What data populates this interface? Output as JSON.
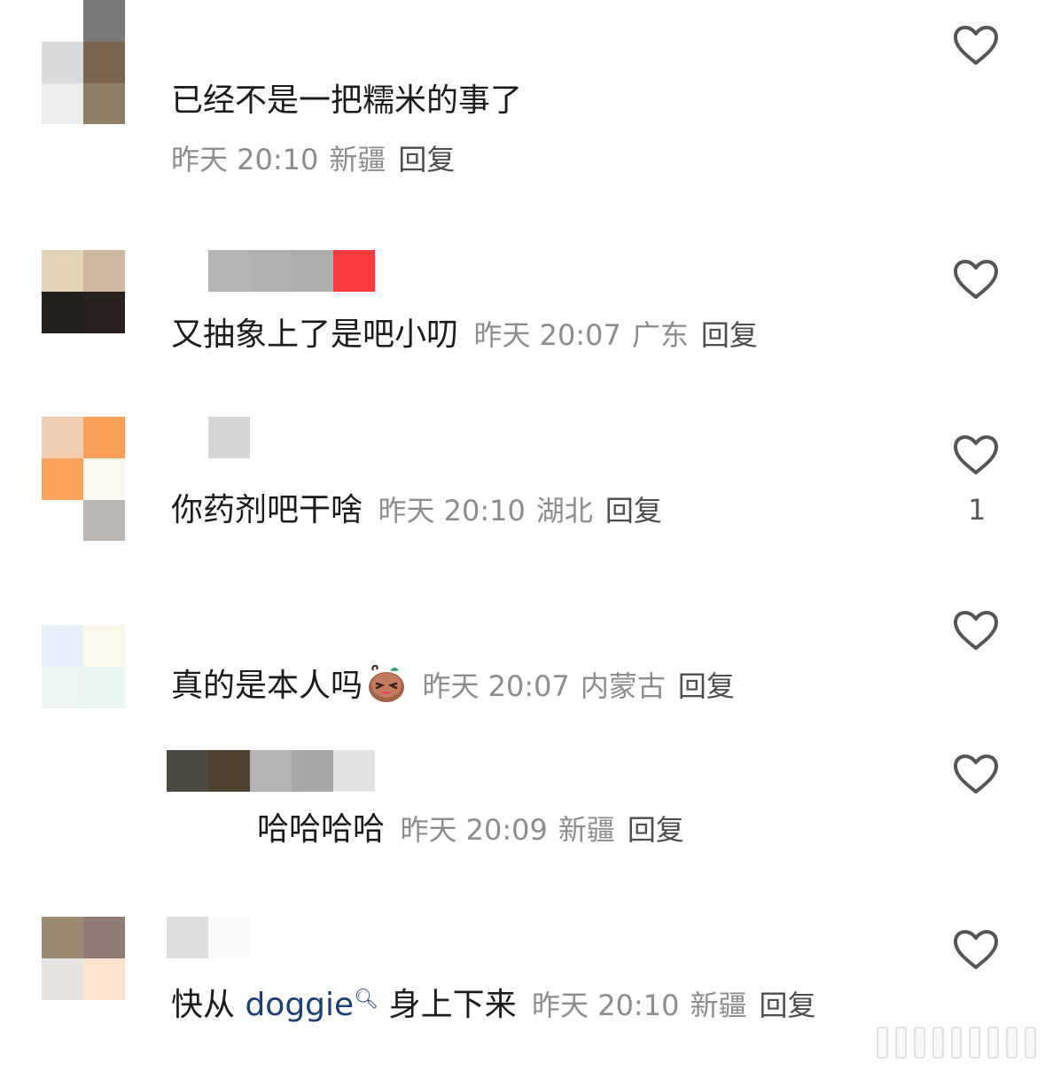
{
  "comments": [
    {
      "text": "已经不是一把糯米的事了",
      "time": "昨天 20:10",
      "location": "新疆",
      "reply": "回复",
      "avatar": [
        "#ffffff",
        "#7b7878",
        "#d9d9d9",
        "#7b6450",
        "#ececec",
        "#8e7e63"
      ]
    },
    {
      "text": "又抽象上了是吧小叨",
      "time": "昨天 20:07",
      "location": "广东",
      "reply": "回复",
      "avatar": [
        "#e4d3b6",
        "#cdb8a0",
        "#24201e",
        "#28211d"
      ],
      "name_blocks": [
        "#b3b3b3",
        "#b0b0b0",
        "#acacac",
        "#fc3b3e"
      ]
    },
    {
      "text": "你药剂吧干啥",
      "time": "昨天 20:10",
      "location": "湖北",
      "reply": "回复",
      "avatar": [
        "#f3cdb0",
        "#f8a05b",
        "#f9a35f",
        "#fbf7f1",
        "#ffffff",
        "#bcb6b3"
      ],
      "name_blocks": [
        "#d6d6d6"
      ],
      "likes": "1"
    },
    {
      "text": "真的是本人吗",
      "time": "昨天 20:07",
      "location": "内蒙古",
      "reply": "回复",
      "avatar": [
        "#e6f0fb",
        "#fdf9ea",
        "#eef6f1",
        "#e9f7f3"
      ],
      "emoji": "face-emoji"
    },
    {
      "text": "哈哈哈哈",
      "time": "昨天 20:09",
      "location": "新疆",
      "reply": "回复",
      "name_blocks": [
        "#4c4a42",
        "#4e4332",
        "#b4b4b4",
        "#a9a9a9",
        "#e2e2e2"
      ],
      "is_reply": true
    },
    {
      "text_before": "快从 ",
      "mention": "doggie",
      "text_after": " 身上下来",
      "time": "昨天 20:10",
      "location": "新疆",
      "reply": "回复",
      "avatar": [
        "#9a8c72",
        "#917c74",
        "#e6e3e1",
        "#fde3cc"
      ],
      "name_blocks": [
        "#dddddd",
        "#fafafa"
      ]
    }
  ],
  "icons": {
    "like": "heart-outline-icon",
    "search": "search-icon"
  },
  "colors": {
    "text": "#1b1b1b",
    "meta": "#8d8d8d",
    "mention": "#1d3f72"
  }
}
